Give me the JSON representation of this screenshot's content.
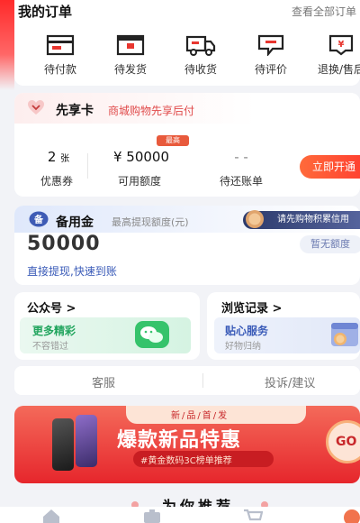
{
  "orders": {
    "title": "我的订单",
    "view_all": "查看全部订单",
    "items": [
      {
        "label": "待付款",
        "icon": "wallet-icon"
      },
      {
        "label": "待发货",
        "icon": "package-icon"
      },
      {
        "label": "待收货",
        "icon": "truck-icon"
      },
      {
        "label": "待评价",
        "icon": "comment-icon"
      },
      {
        "label": "退换/售后",
        "icon": "refund-icon"
      }
    ]
  },
  "member": {
    "title": "先享卡",
    "subtitle": "商城购物先享后付",
    "coupons_value": "2",
    "coupons_unit": "张",
    "coupons_label": "优惠券",
    "limit_value": "¥ 50000",
    "limit_tag": "最高",
    "limit_label": "可用额度",
    "bill_value": "- -",
    "bill_label": "待还账单",
    "activate_button": "立即开通"
  },
  "reserve": {
    "title": "备用金",
    "subtitle": "最高提现额度(元)",
    "promo": "请先购物积累信用",
    "amount": "50000",
    "no_limit": "暂无额度",
    "link": "直接提现,快速到账"
  },
  "mini_cards": {
    "official": {
      "title": "公众号 >",
      "inner_title": "更多精彩",
      "inner_sub": "不容错过"
    },
    "history": {
      "title": "浏览记录 >",
      "inner_title": "贴心服务",
      "inner_sub": "好物归纳"
    }
  },
  "service": {
    "customer_service": "客服",
    "complaint": "投诉/建议"
  },
  "banner": {
    "tag": "新/品/首/发",
    "title": "爆款新品特惠",
    "subtitle": "#黄金数码3C榜单推荐",
    "go": "GO"
  },
  "recommend_title": "为你推荐",
  "colors": {
    "accent": "#e8362f",
    "blue": "#3a5bb8"
  }
}
